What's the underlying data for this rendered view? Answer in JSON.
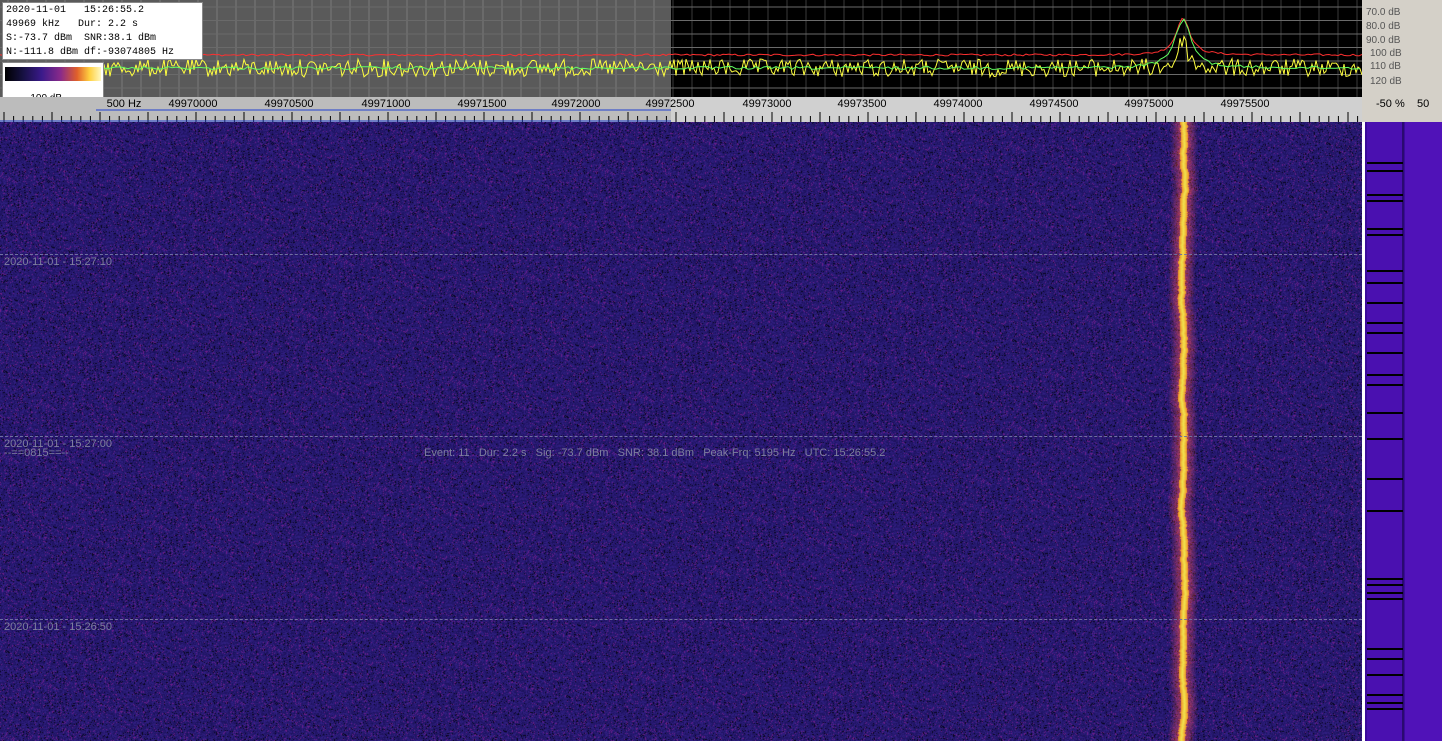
{
  "info": {
    "datetime": "2020-11-01   15:26:55.2",
    "freq_dur": "49969 kHz   Dur: 2.2 s",
    "signal_snr": "S:-73.7 dBm  SNR:38.1 dBm",
    "noise_df": "N:-111.8 dBm df:-93074805 Hz"
  },
  "legend": {
    "label": "-100 dB"
  },
  "db_scale": [
    "70.0 dB",
    "80.0 dB",
    "90.0 dB",
    "100 dB",
    "110 dB",
    "120 dB"
  ],
  "freq_axis": {
    "labels": [
      "500 Hz",
      "49970000",
      "49970500",
      "49971000",
      "49971500",
      "49972000",
      "49972500",
      "49973000",
      "49973500",
      "49974000",
      "49974500",
      "49975000",
      "49975500"
    ]
  },
  "percent_header": {
    "label": "-50 %",
    "value": "50"
  },
  "waterfall": {
    "time_labels": [
      "2020-11-01 - 15:27:10",
      "2020-11-01 - 15:27:00",
      "2020-11-01 - 15:26:50"
    ],
    "tag": "--==0815==--",
    "event": "Event: 11   Dur: 2.2 s   Sig: -73.7 dBm   SNR: 38.1 dBm   Peak-Frq: 5195 Hz   UTC: 15:26:55.2"
  },
  "colors": {
    "waterfall_bg": "#1a1560",
    "spectrum_yellow": "#ffff40",
    "spectrum_green": "#60ff60",
    "spectrum_red": "#ff3030",
    "signal_orange": "#ffb030"
  }
}
